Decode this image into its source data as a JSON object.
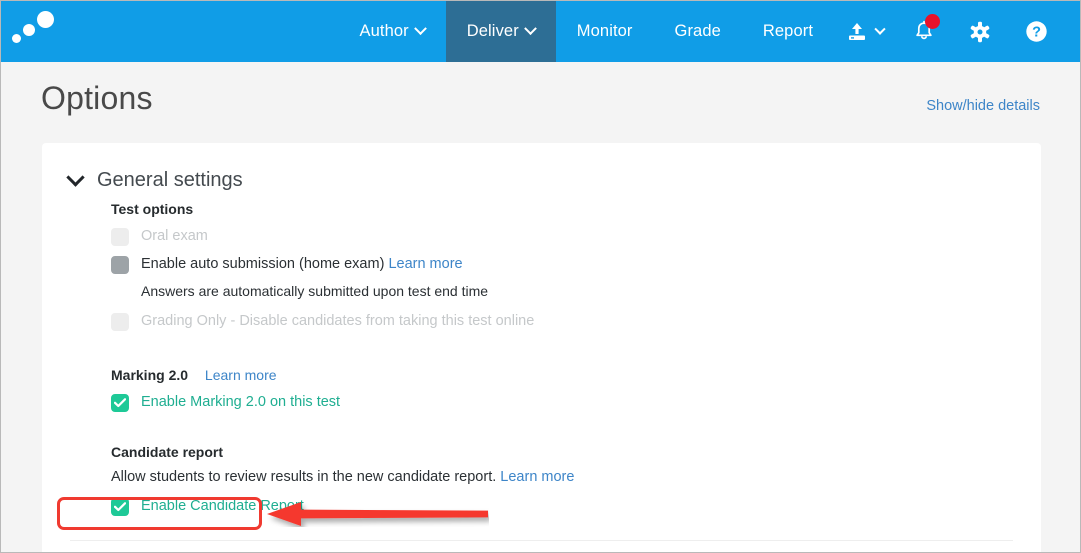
{
  "app": {
    "logo_name": "inspera-logo"
  },
  "topnav": {
    "items": [
      {
        "label": "Author",
        "has_caret": true,
        "active": false,
        "name": "nav-item-author"
      },
      {
        "label": "Deliver",
        "has_caret": true,
        "active": true,
        "name": "nav-item-deliver"
      },
      {
        "label": "Monitor",
        "has_caret": false,
        "active": false,
        "name": "nav-item-monitor"
      },
      {
        "label": "Grade",
        "has_caret": false,
        "active": false,
        "name": "nav-item-grade"
      },
      {
        "label": "Report",
        "has_caret": false,
        "active": false,
        "name": "nav-item-report"
      }
    ],
    "icons": [
      {
        "name": "upload-icon",
        "glyph": "upload",
        "badge": false
      },
      {
        "name": "notifications-icon",
        "glyph": "bell",
        "badge": true
      },
      {
        "name": "settings-gear-icon",
        "glyph": "gear",
        "badge": false
      },
      {
        "name": "help-icon",
        "glyph": "question-mark",
        "badge": false
      }
    ],
    "active_tab_color": "#2d6e95",
    "bar_color": "#109de7",
    "badge_color": "#e8122a"
  },
  "page": {
    "title": "Options",
    "show_hide_link": "Show/hide details"
  },
  "card": {
    "header": "General settings",
    "sections": {
      "test_options": {
        "title": "Test options",
        "rows": [
          {
            "label": "Oral exam",
            "checkbox_state": "unchecked-disabled",
            "disabled": true,
            "learn_more": null,
            "help_text": null,
            "name": "checkbox-row-oral-exam"
          },
          {
            "label": "Enable auto submission (home exam)",
            "checkbox_state": "unchecked",
            "disabled": false,
            "learn_more": "Learn more",
            "help_text": "Answers are automatically submitted upon test end time",
            "name": "checkbox-row-auto-submission"
          },
          {
            "label": "Grading Only - Disable candidates from taking this test online",
            "checkbox_state": "unchecked-disabled",
            "disabled": true,
            "learn_more": null,
            "help_text": null,
            "name": "checkbox-row-grading-only"
          }
        ]
      },
      "marking": {
        "title": "Marking 2.0",
        "learn_more": "Learn more",
        "row": {
          "label": "Enable Marking 2.0 on this test",
          "checkbox_state": "checked",
          "name": "checkbox-row-enable-marking"
        }
      },
      "candidate_report": {
        "title": "Candidate report",
        "description": "Allow students to review results in the new candidate report.",
        "learn_more": "Learn more",
        "row": {
          "label": "Enable Candidate Report",
          "checkbox_state": "checked",
          "highlighted": true,
          "name": "checkbox-row-enable-candidate-report"
        }
      }
    }
  },
  "annotations": {
    "highlight_color": "#f03a30",
    "box_target": "Enable Candidate Report",
    "arrow_direction": "left"
  },
  "colors": {
    "accent_blue": "#109de7",
    "link_blue": "#3d85c8",
    "checkbox_green": "#1ec997",
    "green_label": "#1fae91",
    "page_bg": "#f4f4f4"
  }
}
